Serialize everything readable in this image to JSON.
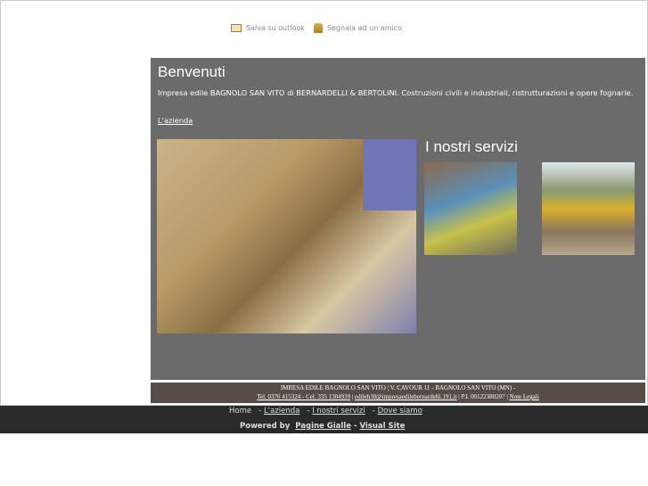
{
  "toolbar": {
    "save_outlook": "Salva su outlook",
    "tell_friend": "Segnala ad un amico"
  },
  "main": {
    "title": "Benvenuti",
    "intro": "Impresa edile BAGNOLO SAN VITO di BERNARDELLI & BERTOLINI. Costruzioni civili e industriali, ristrutturazioni e opere fognarie.",
    "link": "L'azienda",
    "services_title": "I nostri servizi"
  },
  "footer": {
    "line1": "IMRESA EDILE BAGNOLO SAN VITO | V. CAVOUR 11 - BAGNOLO SAN VITO (MN) -",
    "phones": "Tel. 0376 415324 - Cel. 335 1304939",
    "sep1": " | ",
    "email": "edileb38@impresaedilebernardelli.191.it",
    "piva": " | P.I. 00122380207 | ",
    "legal": "Note Legali"
  },
  "nav": {
    "home": "Home",
    "sep": " - ",
    "azienda": "L'azienda",
    "servizi": "I nostri servizi",
    "dove": "Dove siamo"
  },
  "powered": {
    "label": "Powered by ",
    "pg": "Pagine Gialle",
    "dash": " - ",
    "vs": "Visual Site"
  }
}
